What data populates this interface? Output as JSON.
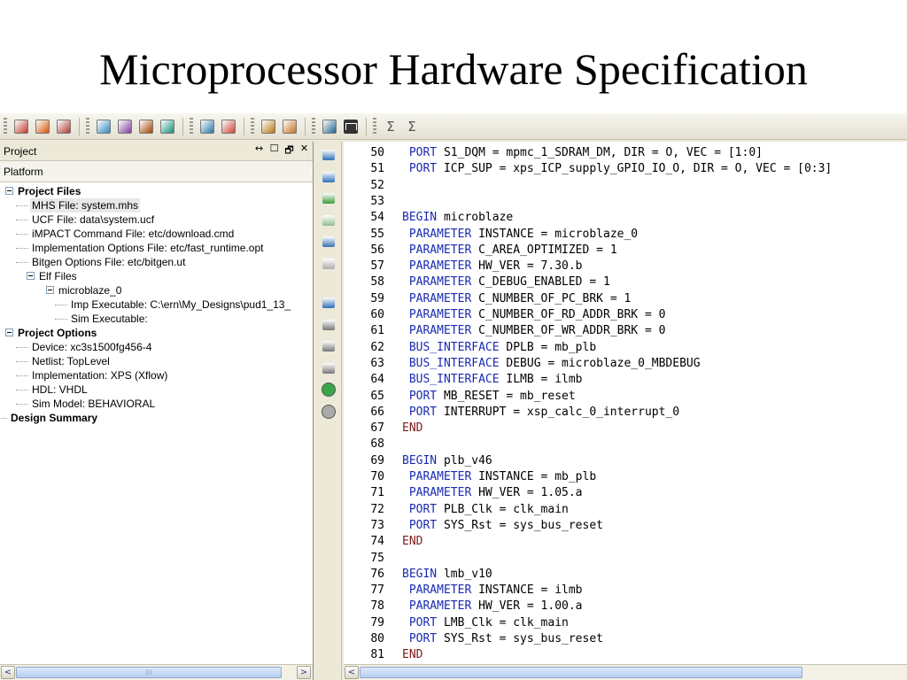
{
  "slide": {
    "title": "Microprocessor Hardware Specification"
  },
  "toolbar": {
    "icon_groups": [
      [
        "pencil-icon",
        "open-folder-icon",
        "save-icon"
      ],
      [
        "check-sheet-icon",
        "gear-sheet-icon",
        "diamond-icon",
        "process-icon"
      ],
      [
        "network-icon",
        "sheet-icon"
      ],
      [
        "package-icon",
        "package-icon-2"
      ],
      [
        "schematic-icon",
        "waveform-icon"
      ],
      [
        "sigma-icon",
        "sigma-icon-2"
      ]
    ],
    "sigma": "Σ"
  },
  "project_panel": {
    "title": "Project",
    "controls": [
      "↔",
      "☐",
      "🗗",
      "✕"
    ],
    "subheader": "Platform",
    "tree": [
      {
        "label": "Project Files",
        "level": 0,
        "bold": true,
        "expander": true
      },
      {
        "label": "MHS File: system.mhs",
        "level": 1,
        "selected": true
      },
      {
        "label": "UCF File: data\\system.ucf",
        "level": 1
      },
      {
        "label": "iMPACT Command File: etc/download.cmd",
        "level": 1
      },
      {
        "label": "Implementation Options File: etc/fast_runtime.opt",
        "level": 1
      },
      {
        "label": "Bitgen Options File: etc/bitgen.ut",
        "level": 1
      },
      {
        "label": "Elf Files",
        "level": 1,
        "expander": true
      },
      {
        "label": "microblaze_0",
        "level": 2,
        "expander": true
      },
      {
        "label": "Imp Executable: C:\\ern\\My_Designs\\pud1_13_",
        "level": 3
      },
      {
        "label": "Sim Executable:",
        "level": 3
      },
      {
        "label": "Project Options",
        "level": 0,
        "bold": true,
        "expander": true
      },
      {
        "label": "Device: xc3s1500fg456-4",
        "level": 1
      },
      {
        "label": "Netlist: TopLevel",
        "level": 1
      },
      {
        "label": "Implementation: XPS (Xflow)",
        "level": 1
      },
      {
        "label": "HDL: VHDL",
        "level": 1
      },
      {
        "label": "Sim Model: BEHAVIORAL",
        "level": 1
      },
      {
        "label": "Design Summary",
        "level": 0,
        "bold": true
      }
    ],
    "scroll_left": "<",
    "scroll_right": ">",
    "scroll_grip": "III"
  },
  "side_tools": [
    "indent-icon",
    "outdent-icon",
    "comment-icon",
    "uncomment-icon",
    "wrap-icon",
    "unwrap-icon",
    "bookmark-icon",
    "tool-icon-1",
    "tool-icon-2",
    "tool-icon-3",
    "back-arrow-icon",
    "forward-arrow-icon"
  ],
  "editor": {
    "scroll_left": "<",
    "lines": [
      {
        "n": "50",
        "kw": " PORT",
        "rest": " S1_DQM = mpmc_1_SDRAM_DM, DIR = O, VEC = [1:0]"
      },
      {
        "n": "51",
        "kw": " PORT",
        "rest": " ICP_SUP = xps_ICP_supply_GPIO_IO_O, DIR = O, VEC = [0:3]"
      },
      {
        "n": "52",
        "kw": "",
        "rest": ""
      },
      {
        "n": "53",
        "kw": "",
        "rest": ""
      },
      {
        "n": "54",
        "kw": "BEGIN",
        "rest": " microblaze"
      },
      {
        "n": "55",
        "kw": " PARAMETER",
        "rest": " INSTANCE = microblaze_0"
      },
      {
        "n": "56",
        "kw": " PARAMETER",
        "rest": " C_AREA_OPTIMIZED = 1"
      },
      {
        "n": "57",
        "kw": " PARAMETER",
        "rest": " HW_VER = 7.30.b"
      },
      {
        "n": "58",
        "kw": " PARAMETER",
        "rest": " C_DEBUG_ENABLED = 1"
      },
      {
        "n": "59",
        "kw": " PARAMETER",
        "rest": " C_NUMBER_OF_PC_BRK = 1"
      },
      {
        "n": "60",
        "kw": " PARAMETER",
        "rest": " C_NUMBER_OF_RD_ADDR_BRK = 0"
      },
      {
        "n": "61",
        "kw": " PARAMETER",
        "rest": " C_NUMBER_OF_WR_ADDR_BRK = 0"
      },
      {
        "n": "62",
        "kw": " BUS_INTERFACE",
        "rest": " DPLB = mb_plb"
      },
      {
        "n": "63",
        "kw": " BUS_INTERFACE",
        "rest": " DEBUG = microblaze_0_MBDEBUG"
      },
      {
        "n": "64",
        "kw": " BUS_INTERFACE",
        "rest": " ILMB = ilmb"
      },
      {
        "n": "65",
        "kw": " PORT",
        "rest": " MB_RESET = mb_reset"
      },
      {
        "n": "66",
        "kw": " PORT",
        "rest": " INTERRUPT = xsp_calc_0_interrupt_0"
      },
      {
        "n": "67",
        "kw": "END",
        "rest": "",
        "end": true
      },
      {
        "n": "68",
        "kw": "",
        "rest": ""
      },
      {
        "n": "69",
        "kw": "BEGIN",
        "rest": " plb_v46"
      },
      {
        "n": "70",
        "kw": " PARAMETER",
        "rest": " INSTANCE = mb_plb"
      },
      {
        "n": "71",
        "kw": " PARAMETER",
        "rest": " HW_VER = 1.05.a"
      },
      {
        "n": "72",
        "kw": " PORT",
        "rest": " PLB_Clk = clk_main"
      },
      {
        "n": "73",
        "kw": " PORT",
        "rest": " SYS_Rst = sys_bus_reset"
      },
      {
        "n": "74",
        "kw": "END",
        "rest": "",
        "end": true
      },
      {
        "n": "75",
        "kw": "",
        "rest": ""
      },
      {
        "n": "76",
        "kw": "BEGIN",
        "rest": " lmb_v10"
      },
      {
        "n": "77",
        "kw": " PARAMETER",
        "rest": " INSTANCE = ilmb"
      },
      {
        "n": "78",
        "kw": " PARAMETER",
        "rest": " HW_VER = 1.00.a"
      },
      {
        "n": "79",
        "kw": " PORT",
        "rest": " LMB_Clk = clk_main"
      },
      {
        "n": "80",
        "kw": " PORT",
        "rest": " SYS_Rst = sys_bus_reset"
      },
      {
        "n": "81",
        "kw": "END",
        "rest": "",
        "end": true
      }
    ]
  },
  "colors": {
    "keyword": "#1a2ab3",
    "end_keyword": "#7f1a1a",
    "chrome": "#ece9d8"
  }
}
